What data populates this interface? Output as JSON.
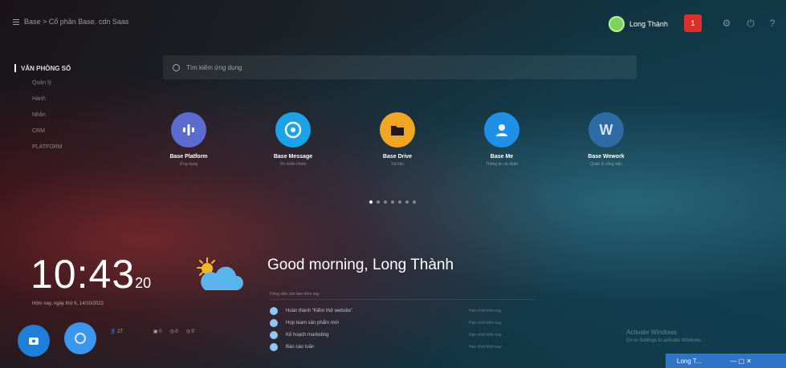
{
  "topbar": {
    "breadcrumb": "Base > Cổ phần Base. cdn Saas"
  },
  "user": {
    "name": "Long Thành",
    "notification_count": "1"
  },
  "sidebar": {
    "title": "VĂN PHÒNG SỐ",
    "items": [
      "Quản lý",
      "Hành",
      "Nhân",
      "CRM",
      "PLATFORM"
    ]
  },
  "search": {
    "placeholder": "Tìm kiếm ứng dụng"
  },
  "apps": [
    {
      "name": "Base Platform",
      "sub": "Ứng dụng",
      "color": "#5b6bd0"
    },
    {
      "name": "Base Message",
      "sub": "Tin nhắn nhóm",
      "color": "#1aa3e8"
    },
    {
      "name": "Base Drive",
      "sub": "Tài liệu",
      "color": "#f0a623"
    },
    {
      "name": "Base Me",
      "sub": "Thông tin cá nhân",
      "color": "#1e90e8"
    },
    {
      "name": "Base Wework",
      "sub": "Quản lý công việc",
      "color": "#2e6aa3"
    }
  ],
  "pager": {
    "total": 7,
    "active": 0
  },
  "clock": {
    "time": "10:43",
    "seconds": "20",
    "date": "Hôm nay, ngày thứ 6, 14/10/2022"
  },
  "greeting": "Good morning, Long Thành",
  "tasks_header": "Công việc cần làm hôm nay",
  "tasks": [
    {
      "title": "Hoàn thành “Kiểm thử website”",
      "due": "Hạn chót hôm nay"
    },
    {
      "title": "Họp team sản phẩm mới",
      "due": "Hạn chót hôm nay"
    },
    {
      "title": "Kế hoạch marketing",
      "due": "Hạn chót hôm nay"
    },
    {
      "title": "Báo cáo tuần",
      "due": "Hạn chót hôm nay"
    }
  ],
  "stats": [
    "27",
    "0",
    "0",
    "0"
  ],
  "activate": {
    "title": "Activate Windows",
    "sub": "Go to Settings to activate Windows."
  },
  "dock": {
    "label": "Long T...",
    "controls": "— ▢ ✕"
  },
  "colors": {
    "accent": "#3b96f0",
    "notify": "#d9322d",
    "online": "#7cd35a"
  }
}
